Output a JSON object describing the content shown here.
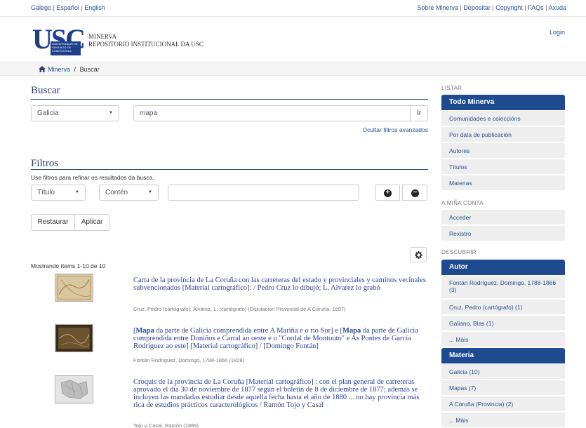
{
  "topbar": {
    "languages": [
      "Galego",
      "Español",
      "English"
    ],
    "links": [
      "Sobre Minerva",
      "Depositar",
      "Copyright",
      "FAQs",
      "Axuda"
    ]
  },
  "header": {
    "logo_text": "USC",
    "logo_subtext": "UNIVERSIDADE DE SANTIAGO DE COMPOSTELA",
    "brand_line1": "MINERVA",
    "brand_line2": "REPOSITORIO INSTITUCIONAL DA USC",
    "login": "Login"
  },
  "breadcrumb": {
    "home": "Minerva",
    "separator": "/",
    "current": "Buscar"
  },
  "search": {
    "title": "Buscar",
    "scope_value": "Galicia",
    "query_value": "mapa",
    "go_label": "Ir",
    "advanced_link": "Ocultar filtros avanzados"
  },
  "filters": {
    "title": "Filtros",
    "hint": "Use filtros para refinar os resultados da busca.",
    "field_value": "Título",
    "op_value": "Contén",
    "value": "",
    "add_icon": "plus-circle-icon",
    "remove_icon": "minus-circle-icon",
    "reset_label": "Restaurar",
    "apply_label": "Aplicar"
  },
  "results": {
    "showing": "Mostrando ítems 1-10 de 10",
    "items": [
      {
        "title": "Carta de la provincia de La Coruña con las carreteras del estado y provinciales y caminos vecinales subvencionados [Material cartográfico]: / Pedro Cruz lo dibujó; L. Alvarez lo grabó",
        "meta": "Cruz, Pedro (cartógrafo); Álvarez, L. (cartógrafo) (Diputación Provincial de A Coruña, 1897)"
      },
      {
        "title_parts": [
          "Mapa",
          " da parte de Galicia comprendida entre A Mariña e o rio Sor] e [",
          "Mapa",
          " da parte de Galicia comprendida entre Doniños e Carral ao oeste e o \"Cordal de Montouto\" e As Pontes de García Rodríguez ao este] [Material cartográfico] / [Domingo Fontán]"
        ],
        "title_prefix": "[",
        "meta": "Fontán Rodríguez, Domingo, 1788-1866 (1828)"
      },
      {
        "title": "Croquis de la provincia de La Coruña [Material cartográfico] : con el plan general de carreteras aprovado el dia 30 de noviembre de 1877 según el boletín de 8 de diciembre de 1877; además se incluyen las mandadas estudiar desde aquella fecha hasta el año de 1880 ... no hay provincia más rica de estudios prácticos caracterológicos / Ramón Tojo y Casal",
        "meta": "Tojo y Casal, Ramón (1889)"
      }
    ]
  },
  "sidebar": {
    "listar_heading": "LISTAR",
    "listar_head": "Todo Minerva",
    "listar_items": [
      "Comunidades e coleccións",
      "Por data de publicación",
      "Autores",
      "Títulos",
      "Materias"
    ],
    "account_heading": "A MIÑA CONTA",
    "account_items": [
      "Acceder",
      "Rexistro"
    ],
    "discover_heading": "DESCUBRIR",
    "autor_head": "Autor",
    "autor_items": [
      "Fontán Rodríguez, Domingo, 1788-1866 (3)",
      "Cruz, Pedro (cartógrafo) (1)",
      "Galiano, Blas (1)",
      "... Máis"
    ],
    "materia_head": "Materia",
    "materia_items": [
      "Galicia (10)",
      "Mapas (7)",
      "A Coruña (Provincia) (2)",
      "... Máis"
    ]
  }
}
